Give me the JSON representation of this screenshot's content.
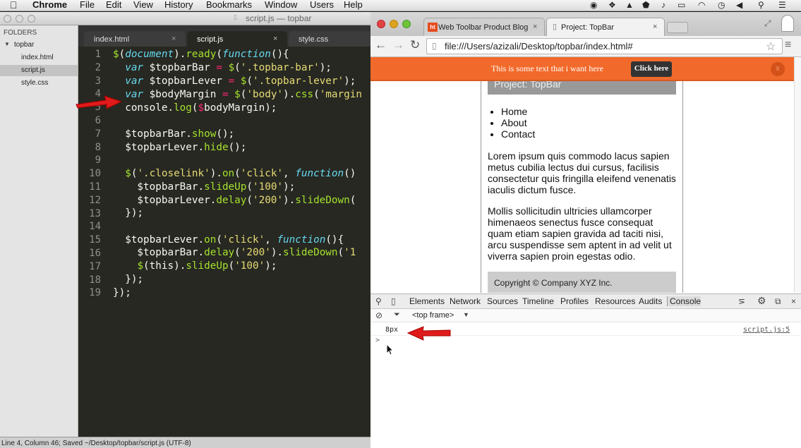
{
  "menubar": {
    "app": "Chrome",
    "items": [
      "File",
      "Edit",
      "View",
      "History",
      "Bookmarks",
      "Window",
      "Users",
      "Help"
    ]
  },
  "sublime": {
    "title": "script.js — topbar",
    "sidebar": {
      "heading": "FOLDERS",
      "folder": "topbar",
      "files": [
        "index.html",
        "script.js",
        "style.css"
      ],
      "selected": "script.js"
    },
    "tabs": [
      {
        "label": "index.html",
        "close": "×"
      },
      {
        "label": "script.js",
        "close": "×"
      },
      {
        "label": "style.css",
        "close": "×"
      }
    ],
    "line_numbers": [
      "1",
      "2",
      "3",
      "4",
      "5",
      "6",
      "7",
      "8",
      "9",
      "10",
      "11",
      "12",
      "13",
      "14",
      "15",
      "16",
      "17",
      "18",
      "19"
    ],
    "status": "Line 4, Column 46; Saved ~/Desktop/topbar/script.js (UTF-8)"
  },
  "chrome": {
    "tabs": [
      {
        "label": "Web Toolbar Product Blog",
        "close": "×",
        "favicon": "ht"
      },
      {
        "label": "Project: TopBar",
        "close": "×"
      }
    ],
    "url": "file:///Users/azizali/Desktop/topbar/index.html#",
    "topbar": {
      "text": "This is some text that i want here",
      "button": "Click here",
      "close": "x"
    },
    "page": {
      "header": "Project: TopBar",
      "nav": [
        "Home",
        "About",
        "Contact"
      ],
      "p1": "Lorem ipsum quis commodo lacus sapien metus cubilia lectus dui cursus, facilisis consectetur quis fringilla eleifend venenatis iaculis dictum fusce.",
      "p2": "Mollis sollicitudin ultricies ullamcorper himenaeos senectus fusce consequat quam etiam sapien gravida ad taciti nisi, arcu suspendisse sem aptent in ad velit ut viverra sapien proin egestas odio.",
      "footer": "Copyright © Company XYZ Inc."
    },
    "devtools": {
      "tabs": [
        "Elements",
        "Network",
        "Sources",
        "Timeline",
        "Profiles",
        "Resources",
        "Audits",
        "Console"
      ],
      "active": "Console",
      "frame": "<top frame>",
      "log_value": "8px",
      "log_source": "script.js:5",
      "prompt": ">"
    }
  },
  "colors": {
    "arrow": "#e01b1b",
    "orange_bar": "#f26a2b",
    "editor_bg": "#272822"
  }
}
